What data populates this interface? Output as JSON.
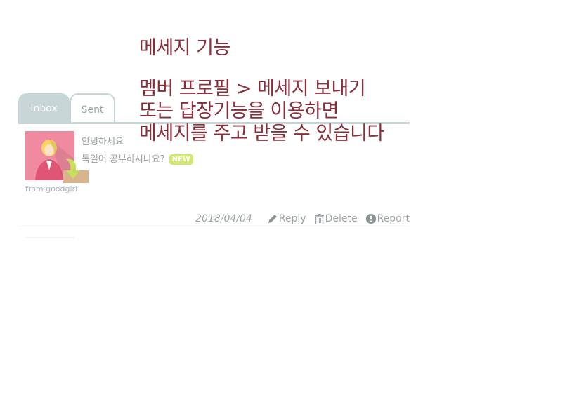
{
  "tabs": [
    {
      "label": "Inbox",
      "active": true
    },
    {
      "label": "Sent",
      "active": false
    }
  ],
  "message": {
    "title": "안녕하세요",
    "body": "독일어 공부하시나요?",
    "badge": "NEW",
    "from": "from goodgirl",
    "date": "2018/04/04",
    "actions": {
      "reply": "Reply",
      "delete": "Delete",
      "report": "Report"
    }
  },
  "overlay": {
    "heading": "메세지 기능",
    "lines": [
      "멤버 프로필 > 메세지 보내기",
      "또는 답장기능을 이용하면",
      "메세지를 주고 받을 수 있습니다"
    ]
  },
  "colors": {
    "tab": "#c9d6d8",
    "overlay_text": "#8a2f3a",
    "new_badge": "#cfe96e"
  }
}
